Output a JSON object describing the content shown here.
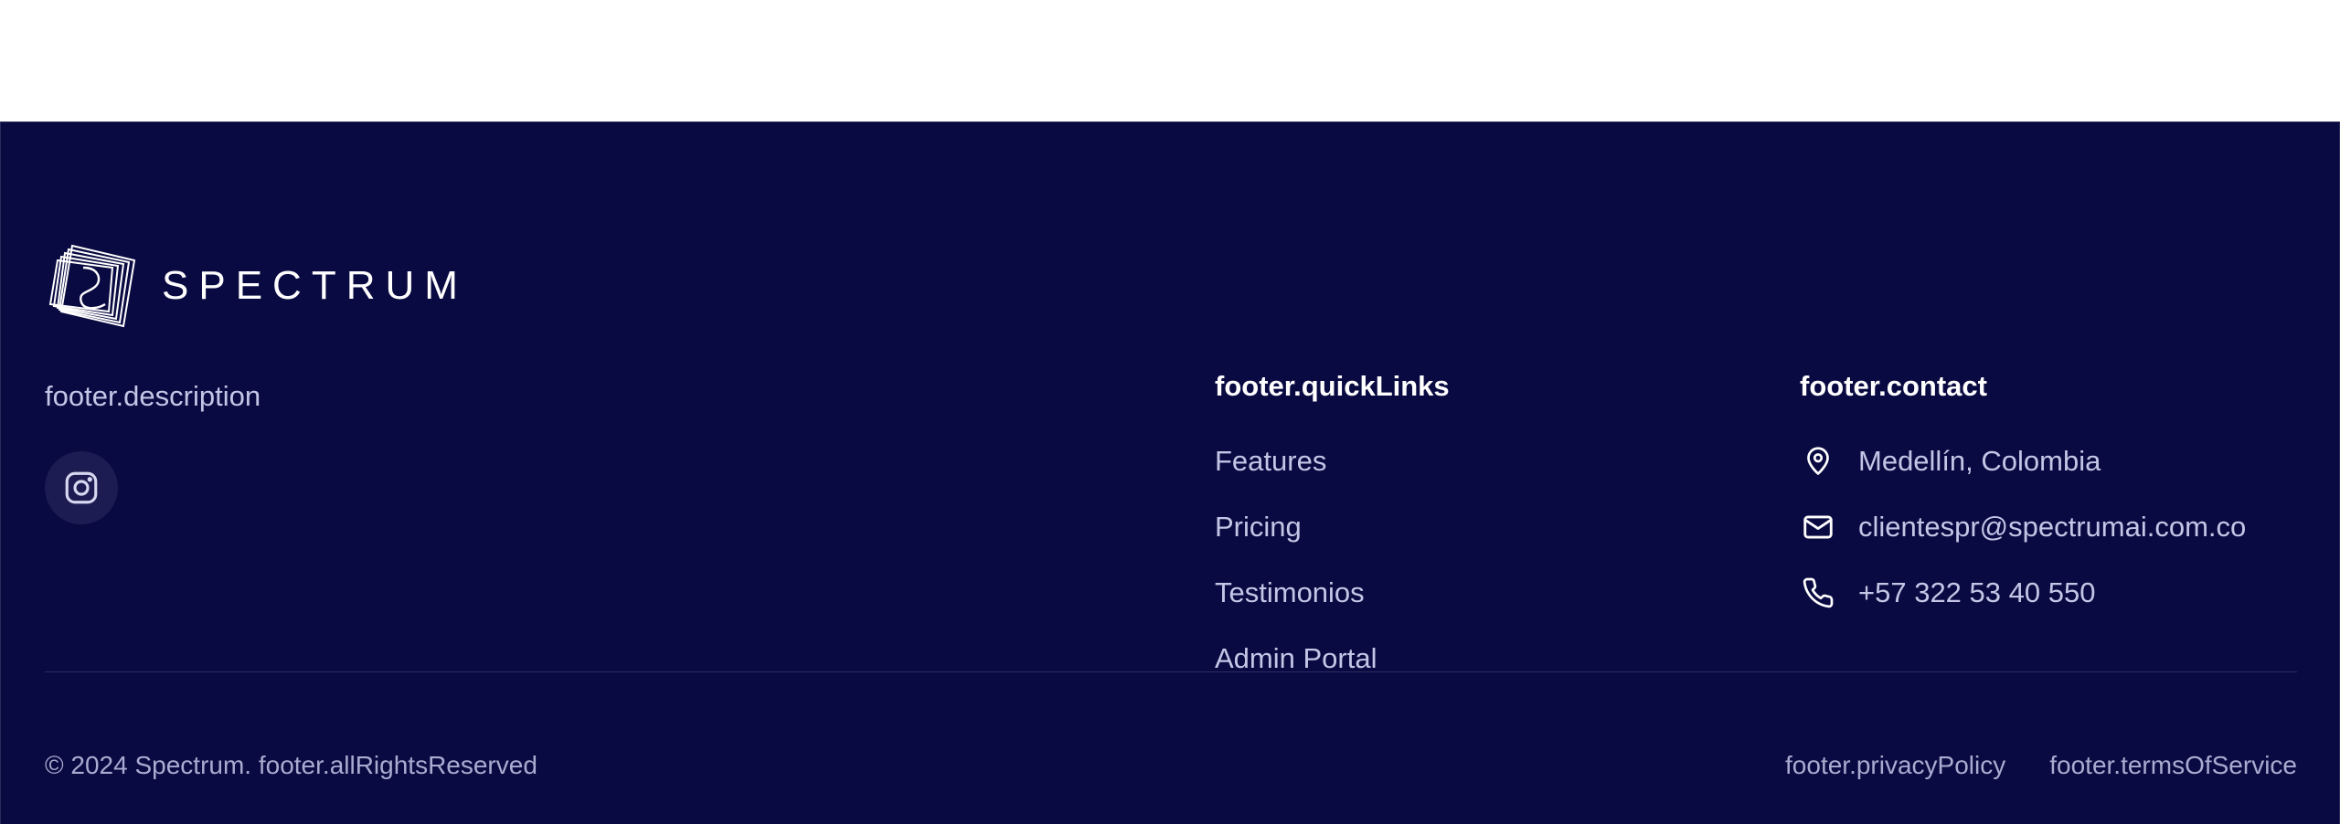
{
  "brand": {
    "name": "SPECTRUM",
    "description": "footer.description",
    "social": [
      {
        "icon": "instagram-icon"
      }
    ]
  },
  "quick_links": {
    "title": "footer.quickLinks",
    "items": [
      {
        "label": "Features"
      },
      {
        "label": "Pricing"
      },
      {
        "label": "Testimonios"
      },
      {
        "label": "Admin Portal"
      }
    ]
  },
  "contact": {
    "title": "footer.contact",
    "items": [
      {
        "icon": "location-pin-icon",
        "text": "Medellín, Colombia"
      },
      {
        "icon": "mail-icon",
        "text": "clientespr@spectrumai.com.co"
      },
      {
        "icon": "phone-icon",
        "text": "+57 322 53 40 550"
      }
    ]
  },
  "bottom": {
    "copyright": "© 2024 Spectrum. footer.allRightsReserved",
    "privacy": "footer.privacyPolicy",
    "terms": "footer.termsOfService"
  },
  "colors": {
    "background": "#0a0a42",
    "text_muted": "#c4c6e6",
    "heading": "#ffffff"
  }
}
